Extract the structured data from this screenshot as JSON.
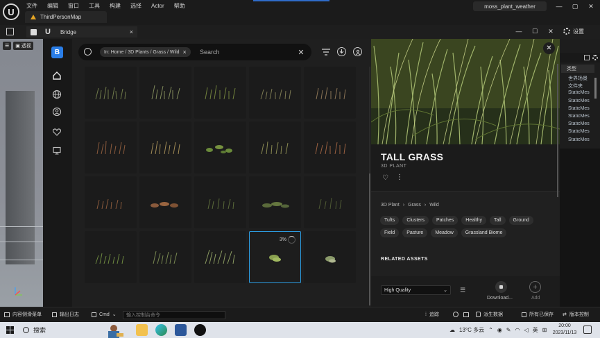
{
  "menu": [
    "文件",
    "编辑",
    "窗口",
    "工具",
    "构建",
    "选择",
    "Actor",
    "帮助"
  ],
  "map_tab": "ThirdPersonMap",
  "project_name": "moss_plant_weather",
  "window_controls": {
    "minimize": "—",
    "maximize": "▢",
    "close": "✕"
  },
  "tab_controls": {
    "minimize": "—",
    "maximize": "☐",
    "close": "✕"
  },
  "bridge_tab": {
    "label": "Bridge",
    "close": "×"
  },
  "settings_label": "设置",
  "viewport": {
    "perspective": "透视"
  },
  "bridge": {
    "logo": "B",
    "search": {
      "breadcrumb": "In: Home / 3D Plants / Grass / Wild",
      "placeholder": "Search",
      "clear": "✕"
    },
    "selected_tile_progress": "3%"
  },
  "detail": {
    "close": "✕",
    "title": "TALL GRASS",
    "type": "3D PLANT",
    "favorite_icon": "♡",
    "more_icon": "⋮",
    "breadcrumb": [
      "3D Plant",
      "Grass",
      "Wild"
    ],
    "breadcrumb_sep": "›",
    "tags": [
      "Tufts",
      "Clusters",
      "Patches",
      "Healthy",
      "Tall",
      "Ground",
      "Field",
      "Pasture",
      "Meadow",
      "Grassland Biome"
    ],
    "related_heading": "RELATED ASSETS",
    "quality": "High Quality",
    "quality_arrow": "⌄",
    "quality_settings_icon": "☰",
    "download_label": "Download...",
    "add_icon": "+",
    "add_label": "Add"
  },
  "outliner": {
    "column": "类型",
    "rows": [
      "世界场景",
      "文件夹",
      "StaticMes",
      "StaticMes",
      "StaticMes",
      "StaticMes",
      "StaticMes",
      "StaticMes",
      "StaticMes"
    ]
  },
  "status_bar": {
    "content_drawer": "内容侧滑菜单",
    "output_log": "输出日志",
    "cmd": "Cmd",
    "console_placeholder": "输入控制台命令",
    "trace": "追踪",
    "derived_data": "派生数据",
    "all_saved": "所有已保存",
    "source_control": "版本控制"
  },
  "taskbar": {
    "search_label": "搜索",
    "weather": "13°C 多云",
    "ime": "英",
    "time": "20:00",
    "date": "2023/11/13"
  },
  "colors": {
    "accent_blue": "#2a7ee8",
    "selection_border": "#2c9ce0",
    "warning": "#e5a524"
  }
}
